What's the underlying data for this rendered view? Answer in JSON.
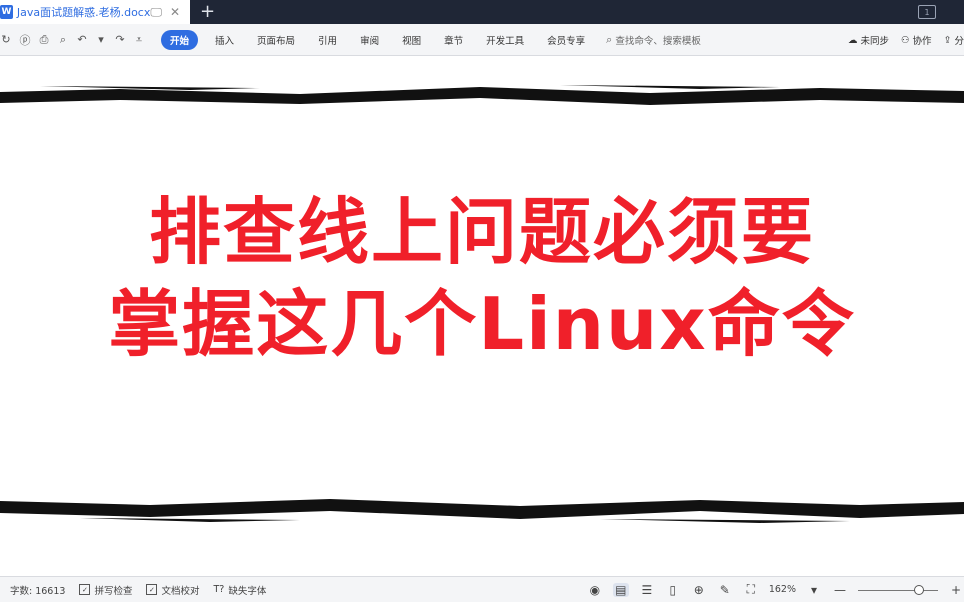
{
  "tab": {
    "logo": "W",
    "title": "Java面试题解惑.老杨.docx",
    "new_tab": "+",
    "window_badge": "1"
  },
  "ribbon": {
    "menu": [
      "开始",
      "插入",
      "页面布局",
      "引用",
      "审阅",
      "视图",
      "章节",
      "开发工具",
      "会员专享"
    ],
    "active_index": 0,
    "search_placeholder": "查找命令、搜索模板",
    "sync_label": "未同步",
    "collab_label": "协作",
    "share_label": "分"
  },
  "document": {
    "headline_line1": "排查线上问题必须要",
    "headline_line2": "掌握这几个Linux命令",
    "headline_color": "#f0202a"
  },
  "statusbar": {
    "word_count": "字数: 16613",
    "spell_check": "拼写检查",
    "doc_proof": "文档校对",
    "missing_font": "缺失字体",
    "zoom": "162%",
    "zoom_level": 0.8
  },
  "colors": {
    "tabbar_bg": "#1f2636",
    "accent": "#2f6de1"
  }
}
